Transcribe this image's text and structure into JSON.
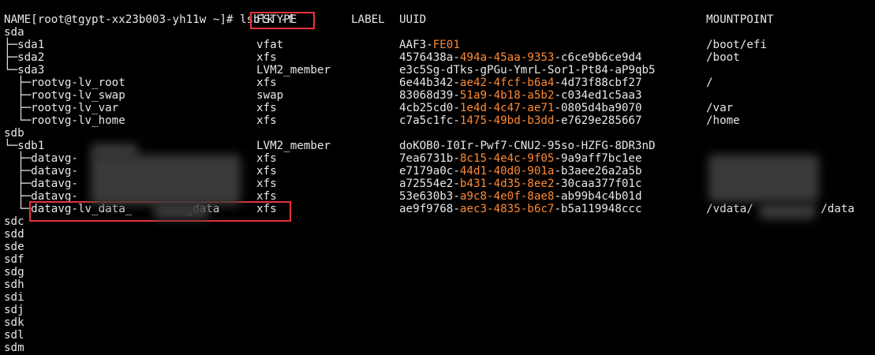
{
  "terminal": {
    "prompt": "[root@tgypt-xx23b003-yh11w ~]# ",
    "command": "lsblk -f",
    "headers": {
      "name": "NAME",
      "fstype": "FSTYPE",
      "label": "LABEL",
      "uuid": "UUID",
      "mountpoint": "MOUNTPOINT"
    },
    "rows": [
      {
        "name": "sda",
        "fstype": "",
        "uuid_a": "",
        "uuid_b": "",
        "uuid_c": "",
        "mount": ""
      },
      {
        "name": "├─sda1",
        "fstype": "vfat",
        "uuid_a": "AAF3-",
        "uuid_b": "FE01",
        "uuid_c": "",
        "mount": "/boot/efi"
      },
      {
        "name": "├─sda2",
        "fstype": "xfs",
        "uuid_a": "4576438a-",
        "uuid_b": "494a-45aa-9353",
        "uuid_c": "-c6ce9b6ce9d4",
        "mount": "/boot"
      },
      {
        "name": "└─sda3",
        "fstype": "LVM2_member",
        "uuid_a": "e3c5Sg-dTks-gPGu-YmrL-Sor1-Pt84-aP9qb5",
        "uuid_b": "",
        "uuid_c": "",
        "mount": ""
      },
      {
        "name": "  ├─rootvg-lv_root",
        "fstype": "xfs",
        "uuid_a": "6e44b342-",
        "uuid_b": "ae42-4fcf-b6a4",
        "uuid_c": "-4d73f88cbf27",
        "mount": "/"
      },
      {
        "name": "  ├─rootvg-lv_swap",
        "fstype": "swap",
        "uuid_a": "83068d39-",
        "uuid_b": "51a9-4b18-a5b2",
        "uuid_c": "-c034ed1c5aa3",
        "mount": ""
      },
      {
        "name": "  ├─rootvg-lv_var",
        "fstype": "xfs",
        "uuid_a": "4cb25cd0-",
        "uuid_b": "1e4d-4c47-ae71",
        "uuid_c": "-0805d4ba9070",
        "mount": "/var"
      },
      {
        "name": "  └─rootvg-lv_home",
        "fstype": "xfs",
        "uuid_a": "c7a5c1fc-",
        "uuid_b": "1475-49bd-b3dd",
        "uuid_c": "-e7629e285667",
        "mount": "/home"
      },
      {
        "name": "sdb",
        "fstype": "",
        "uuid_a": "",
        "uuid_b": "",
        "uuid_c": "",
        "mount": ""
      },
      {
        "name": "└─sdb1",
        "fstype": "LVM2_member",
        "uuid_a": "doKOB0-I0Ir-Pwf7-CNU2-95so-HZFG-8DR3nD",
        "uuid_b": "",
        "uuid_c": "",
        "mount": ""
      },
      {
        "name": "  ├─datavg-",
        "fstype": "xfs",
        "uuid_a": "7ea6731b-",
        "uuid_b": "8c15-4e4c-9f05",
        "uuid_c": "-9a9aff7bc1ee",
        "mount": ""
      },
      {
        "name": "  ├─datavg-",
        "fstype": "xfs",
        "uuid_a": "e7179a0c-",
        "uuid_b": "44d1-40d0-901a",
        "uuid_c": "-b3aee26a2a5b",
        "mount": ""
      },
      {
        "name": "  ├─datavg-",
        "fstype": "xfs",
        "uuid_a": "a72554e2-",
        "uuid_b": "b431-4d35-8ee2",
        "uuid_c": "-30caa377f01c",
        "mount": ""
      },
      {
        "name": "  ├─datavg-",
        "fstype": "xfs",
        "uuid_a": "53e630b3-",
        "uuid_b": "a9c8-4e0f-8ae8",
        "uuid_c": "-ab99b4c4b01d",
        "mount": ""
      },
      {
        "name": "  └─datavg-lv_data_        _data",
        "fstype": "xfs",
        "uuid_a": "ae9f9768-",
        "uuid_b": "aec3-4835-b6c7",
        "uuid_c": "-b5a119948ccc",
        "mount": "/vdata/          /data"
      },
      {
        "name": "sdc",
        "fstype": "",
        "uuid_a": "",
        "uuid_b": "",
        "uuid_c": "",
        "mount": ""
      },
      {
        "name": "sdd",
        "fstype": "",
        "uuid_a": "",
        "uuid_b": "",
        "uuid_c": "",
        "mount": ""
      },
      {
        "name": "sde",
        "fstype": "",
        "uuid_a": "",
        "uuid_b": "",
        "uuid_c": "",
        "mount": ""
      },
      {
        "name": "sdf",
        "fstype": "",
        "uuid_a": "",
        "uuid_b": "",
        "uuid_c": "",
        "mount": ""
      },
      {
        "name": "sdg",
        "fstype": "",
        "uuid_a": "",
        "uuid_b": "",
        "uuid_c": "",
        "mount": ""
      },
      {
        "name": "sdh",
        "fstype": "",
        "uuid_a": "",
        "uuid_b": "",
        "uuid_c": "",
        "mount": ""
      },
      {
        "name": "sdi",
        "fstype": "",
        "uuid_a": "",
        "uuid_b": "",
        "uuid_c": "",
        "mount": ""
      },
      {
        "name": "sdj",
        "fstype": "",
        "uuid_a": "",
        "uuid_b": "",
        "uuid_c": "",
        "mount": ""
      },
      {
        "name": "sdk",
        "fstype": "",
        "uuid_a": "",
        "uuid_b": "",
        "uuid_c": "",
        "mount": ""
      },
      {
        "name": "sdl",
        "fstype": "",
        "uuid_a": "",
        "uuid_b": "",
        "uuid_c": "",
        "mount": ""
      },
      {
        "name": "sdm",
        "fstype": "",
        "uuid_a": "",
        "uuid_b": "",
        "uuid_c": "",
        "mount": ""
      }
    ]
  },
  "colors": {
    "background": "#000000",
    "text": "#e8e8e8",
    "uuid_highlight": "#ff8a33",
    "annotation_box": "#e8323c"
  }
}
